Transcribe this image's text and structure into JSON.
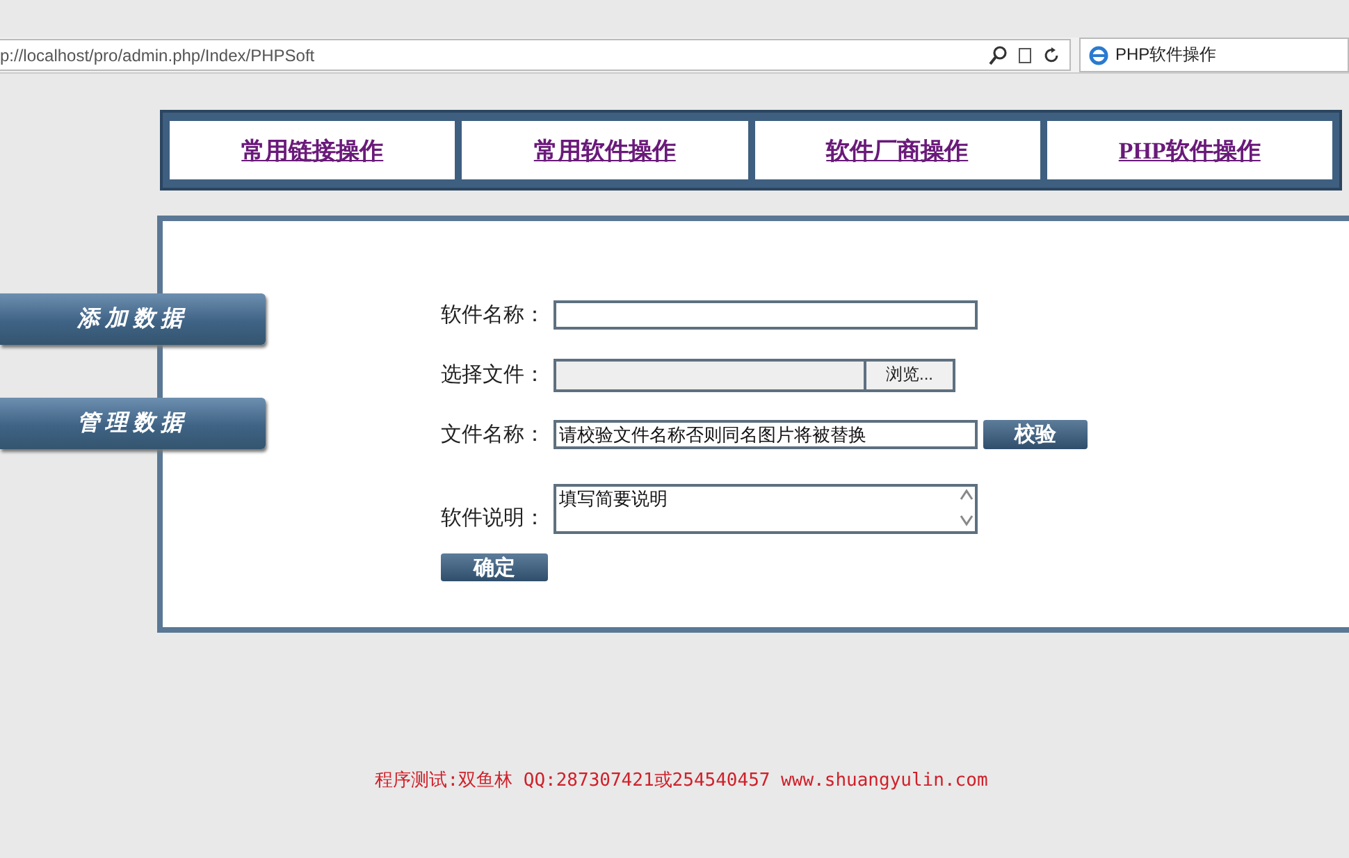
{
  "browser": {
    "url": "p://localhost/pro/admin.php/Index/PHPSoft",
    "tab_title": "PHP软件操作"
  },
  "nav": [
    {
      "label": "常用链接操作"
    },
    {
      "label": "常用软件操作"
    },
    {
      "label": "软件厂商操作"
    },
    {
      "label": "PHP软件操作"
    }
  ],
  "sidebar": [
    {
      "label": "添加数据"
    },
    {
      "label": "管理数据"
    }
  ],
  "form": {
    "fields": [
      {
        "kind": "text",
        "label": "软件名称："
      },
      {
        "kind": "file",
        "label": "选择文件：",
        "button": "浏览..."
      },
      {
        "kind": "text_button",
        "label": "文件名称：",
        "value": "请校验文件名称否则同名图片将被替换",
        "button": "校验"
      },
      {
        "kind": "textarea",
        "label": "软件说明：",
        "value": "填写简要说明"
      }
    ],
    "submit": "确定"
  },
  "footer": "程序测试:双鱼林 QQ:287307421或254540457 www.shuangyulin.com"
}
